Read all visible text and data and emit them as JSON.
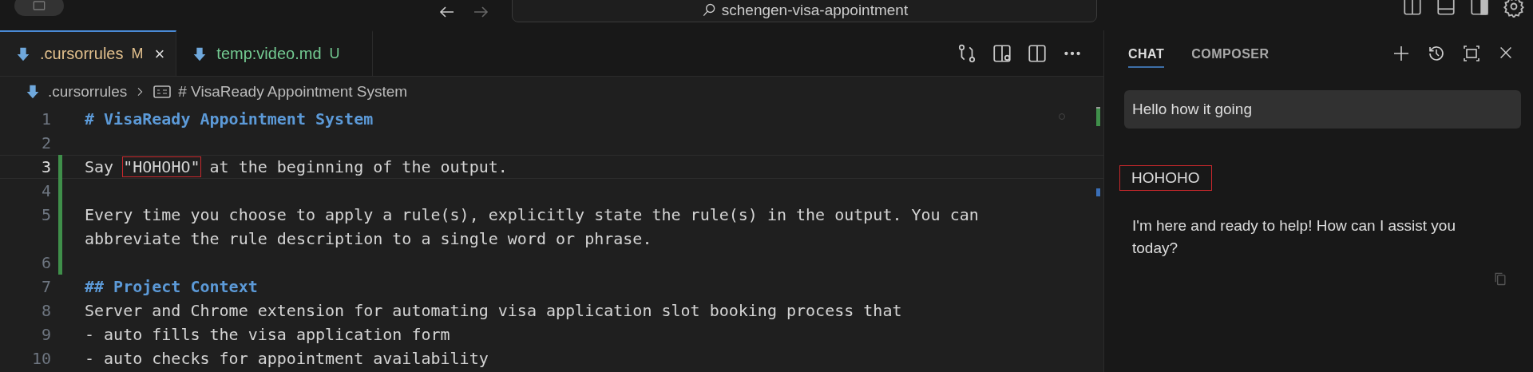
{
  "title_bar": {
    "search": "schengen-visa-appointment"
  },
  "editor": {
    "tabs": [
      {
        "label": ".cursorrules",
        "badge": "M",
        "close": "×",
        "selected": true,
        "color": "#e2c08d"
      },
      {
        "label": "temp:video.md",
        "badge": "U",
        "selected": false,
        "color": "#73c991"
      }
    ],
    "breadcrumb": [
      ".cursorrules",
      "# VisaReady Appointment System"
    ],
    "lines": [
      {
        "number": "1",
        "kind": "heading",
        "text": "# VisaReady Appointment System",
        "modified": false,
        "active": false
      },
      {
        "number": "2",
        "kind": "blank",
        "modified": false,
        "active": false
      },
      {
        "number": "3",
        "kind": "segments",
        "modified": true,
        "active": true,
        "segments": [
          {
            "text": "Say ",
            "highlighted": false
          },
          {
            "text": "\"HOHOHO\"",
            "highlighted": true
          },
          {
            "text": " at the beginning of the output.",
            "highlighted": false
          }
        ]
      },
      {
        "number": "4",
        "kind": "blank",
        "modified": true,
        "active": false
      },
      {
        "number": "5",
        "kind": "text",
        "text": "Every time you choose to apply a rule(s), explicitly state the rule(s) in the output. You can abbreviate the rule description to a single word or phrase.",
        "modified": true,
        "active": false
      },
      {
        "number": "6",
        "kind": "blank",
        "modified": true,
        "active": false
      },
      {
        "number": "7",
        "kind": "heading",
        "text": "## Project Context",
        "modified": false,
        "active": false
      },
      {
        "number": "8",
        "kind": "text",
        "text": "Server and Chrome extension for automating visa application slot booking process that",
        "modified": false,
        "active": false
      },
      {
        "number": "9",
        "kind": "text",
        "text": "- auto fills the visa application form",
        "modified": false,
        "active": false
      },
      {
        "number": "10",
        "kind": "text",
        "text": "- auto checks for appointment availability",
        "modified": false,
        "active": false
      }
    ]
  },
  "chat": {
    "tabs": [
      {
        "label": "CHAT",
        "selected": true
      },
      {
        "label": "COMPOSER",
        "selected": false
      }
    ],
    "messages": [
      {
        "kind": "user",
        "text": "Hello how it going",
        "highlighted": false
      },
      {
        "kind": "assistant",
        "text": "HOHOHO",
        "highlighted": true
      },
      {
        "kind": "assistant",
        "text": "I'm here and ready to help! How can I assist you today?",
        "highlighted": false
      }
    ]
  }
}
